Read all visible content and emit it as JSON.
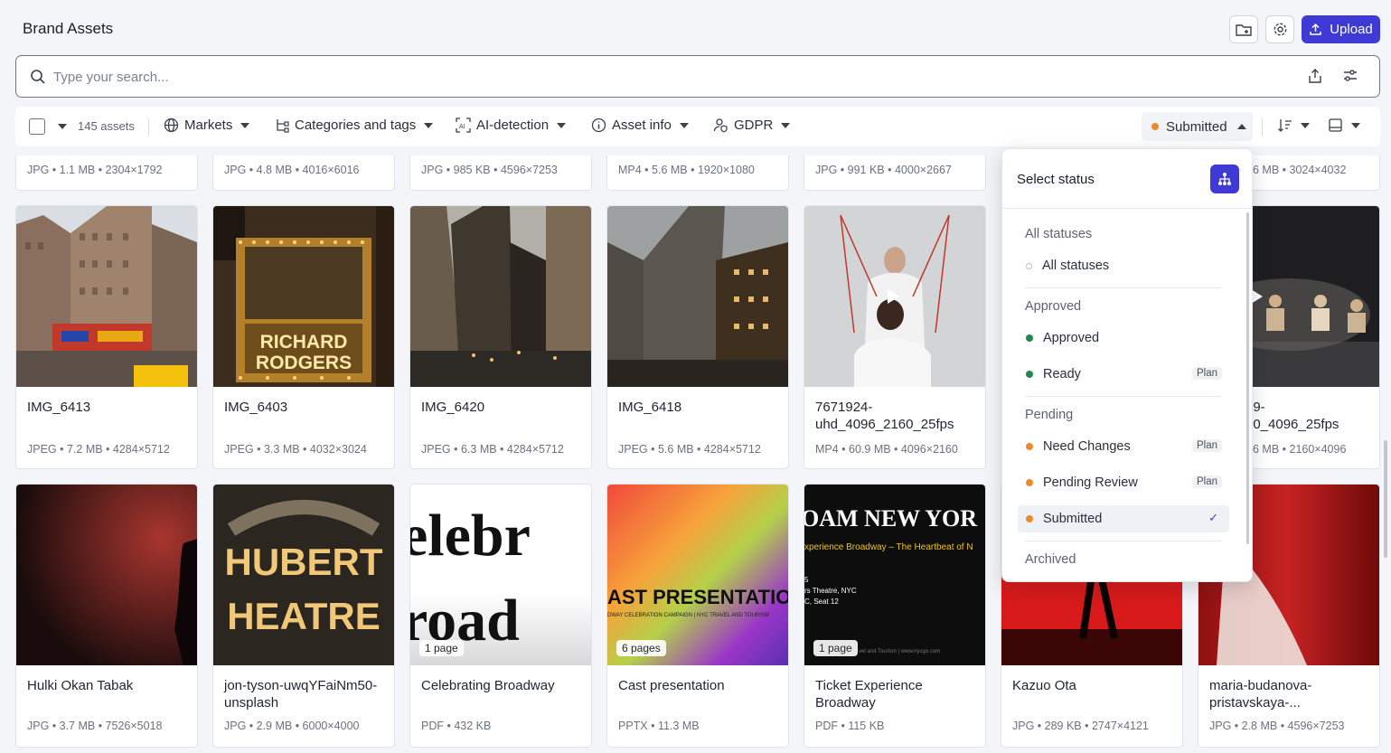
{
  "header": {
    "title": "Brand Assets",
    "upload_label": "Upload"
  },
  "search": {
    "placeholder": "Type your search..."
  },
  "filterbar": {
    "count": "145 assets",
    "filters": [
      "Markets",
      "Categories and tags",
      "AI-detection",
      "Asset info",
      "GDPR"
    ],
    "status_label": "Submitted"
  },
  "top_row_meta": [
    "JPG • 1.1 MB • 2304×1792",
    "JPG • 4.8 MB • 4016×6016",
    "JPG • 985 KB • 4596×7253",
    "MP4 • 5.6 MB • 1920×1080",
    "JPG • 991 KB • 4000×2667",
    "",
    "6 MB • 3024×4032"
  ],
  "row2": [
    {
      "name": "IMG_6413",
      "meta": "JPEG • 7.2 MB • 4284×5712"
    },
    {
      "name": "IMG_6403",
      "meta": "JPEG • 3.3 MB • 4032×3024"
    },
    {
      "name": "IMG_6420",
      "meta": "JPEG • 6.3 MB • 4284×5712"
    },
    {
      "name": "IMG_6418",
      "meta": "JPEG • 5.6 MB • 4284×5712"
    },
    {
      "name": "7671924-uhd_4096_2160_25fps",
      "meta": "MP4 • 60.9 MB • 4096×2160"
    },
    {
      "name": "",
      "meta": ""
    },
    {
      "name": "39-\n60_4096_25fps",
      "meta": "6 MB • 2160×4096"
    }
  ],
  "row3": [
    {
      "name": "Hulki Okan Tabak",
      "meta": "JPG • 3.7 MB • 7526×5018",
      "badge": ""
    },
    {
      "name": "jon-tyson-uwqYFaiNm50-unsplash",
      "meta": "JPG • 2.9 MB • 6000×4000",
      "badge": ""
    },
    {
      "name": "Celebrating Broadway",
      "meta": "PDF • 432 KB",
      "badge": "1 page"
    },
    {
      "name": "Cast presentation",
      "meta": "PPTX • 11.3 MB",
      "badge": "6 pages"
    },
    {
      "name": "Ticket Experience Broadway",
      "meta": "PDF • 115 KB",
      "badge": "1 page"
    },
    {
      "name": "Kazuo Ota",
      "meta": "JPG • 289 KB • 2747×4121",
      "badge": ""
    },
    {
      "name": "maria-budanova-pristavskaya-...",
      "meta": "JPG • 2.8 MB • 4596×7253",
      "badge": ""
    }
  ],
  "thumb_text": {
    "sign1": "RICHARD",
    "sign2": "RODGERS",
    "marquee1": "HUBERT",
    "marquee2": "HEATRE",
    "celeb1": "elebr",
    "celeb2": "road",
    "cast_title": "AST PRESENTATIO",
    "cast_sub": "DWAY CELEBRATION CAMPAIGN | NYC TRAVEL AND TOURISM",
    "ticket_title": "OAM NEW YOR",
    "ticket_sub": "xperience Broadway – The Heartbeat of N",
    "ticket_line1": "5",
    "ticket_line2": "rs Theatre, NYC",
    "ticket_line3": "C, Seat 12",
    "ticket_footer": "vel and Tourism | www.nycgo.com"
  },
  "dropdown": {
    "title": "Select status",
    "sections": [
      {
        "label": "All statuses",
        "items": [
          {
            "label": "All statuses",
            "color": "none",
            "plan": ""
          }
        ]
      },
      {
        "label": "Approved",
        "items": [
          {
            "label": "Approved",
            "color": "#1e8a4c",
            "plan": ""
          },
          {
            "label": "Ready",
            "color": "#1e8a4c",
            "plan": "Plan"
          }
        ]
      },
      {
        "label": "Pending",
        "items": [
          {
            "label": "Need Changes",
            "color": "#ee8a2b",
            "plan": "Plan"
          },
          {
            "label": "Pending Review",
            "color": "#ee8a2b",
            "plan": "Plan"
          },
          {
            "label": "Submitted",
            "color": "#ee8a2b",
            "plan": "",
            "selected": true
          }
        ]
      },
      {
        "label": "Archived",
        "items": []
      }
    ],
    "check": "✓"
  },
  "colors": {
    "accent": "#3f3ad6",
    "approved": "#1e8a4c",
    "pending": "#ee8a2b"
  }
}
